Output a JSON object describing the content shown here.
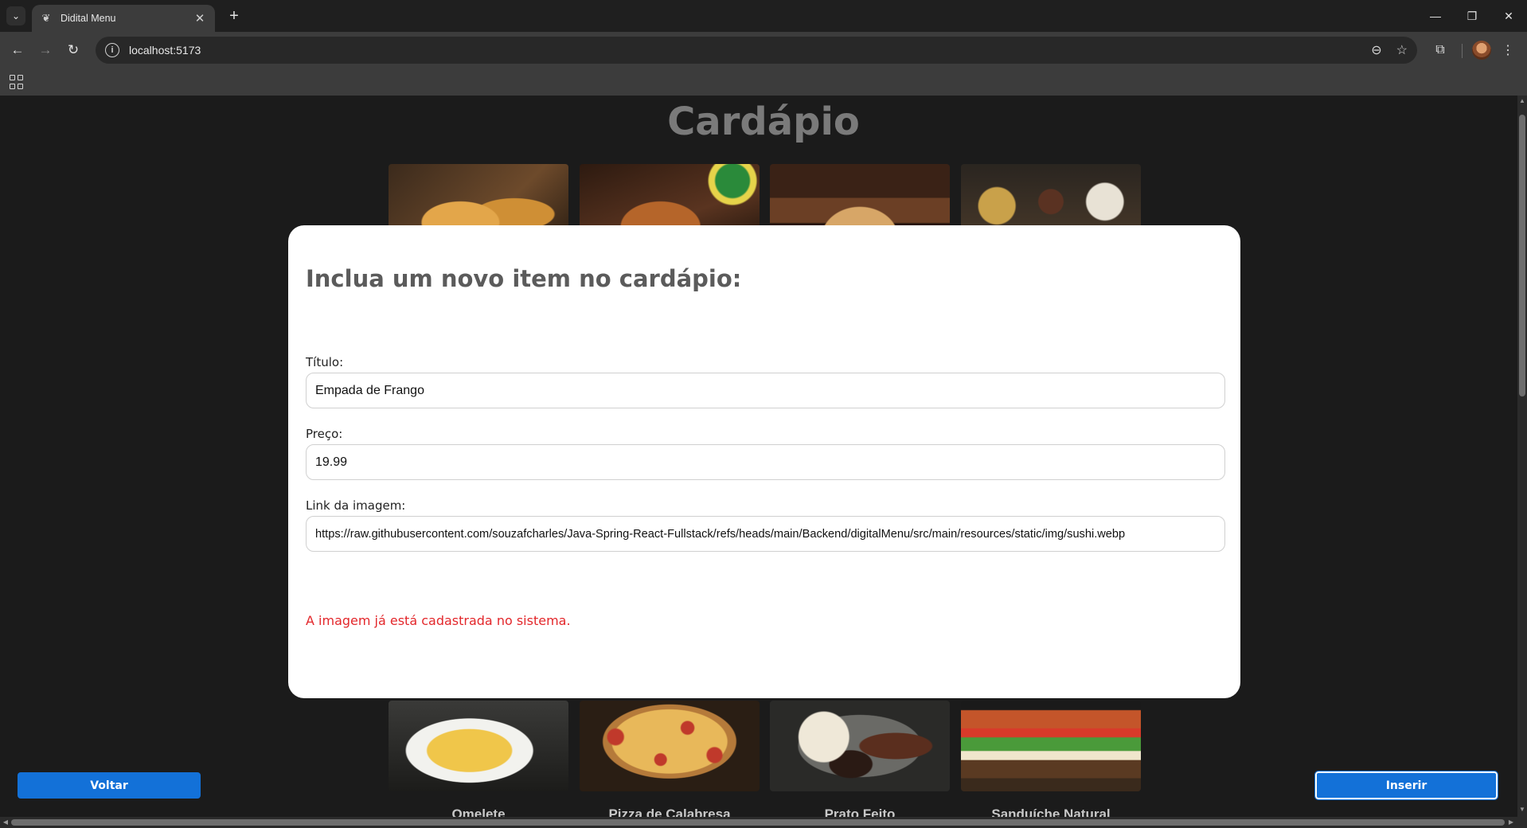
{
  "browser": {
    "tab_title": "Didital Menu",
    "url": "localhost:5173",
    "icons": {
      "tab_list": "chevron-down-icon",
      "favicon": "leaf-icon",
      "tab_close": "close-icon",
      "new_tab": "plus-icon",
      "back": "arrow-left-icon",
      "forward": "arrow-right-icon",
      "reload": "reload-icon",
      "site_info": "info-icon",
      "zoom": "zoom-icon",
      "bookmark": "star-icon",
      "extensions": "puzzle-icon",
      "menu": "kebab-icon",
      "apps": "apps-grid-icon"
    },
    "glyphs": {
      "tab_list": "⌄",
      "favicon": "❦",
      "tab_close": "✕",
      "new_tab": "+",
      "back": "←",
      "forward": "→",
      "reload": "↻",
      "site_info": "i",
      "zoom": "⊖",
      "bookmark": "☆",
      "extensions": "⧉",
      "menu": "⋮",
      "minimize": "—",
      "restore": "❐",
      "close": "✕"
    }
  },
  "page": {
    "title": "Cardápio",
    "top_cards": [
      {
        "image": "fries-image"
      },
      {
        "image": "coxinha-image"
      },
      {
        "image": "restaurant-image"
      },
      {
        "image": "spices-image"
      }
    ],
    "bottom_cards": [
      {
        "image": "omelete-image",
        "label": "Omelete"
      },
      {
        "image": "pizza-image",
        "label": "Pizza de Calabresa"
      },
      {
        "image": "prato-feito-image",
        "label": "Prato Feito"
      },
      {
        "image": "sanduiche-image",
        "label": "Sanduíche Natural"
      }
    ],
    "back_button": "Voltar",
    "insert_button": "Inserir"
  },
  "modal": {
    "title": "Inclua um novo item no cardápio:",
    "fields": {
      "title_label": "Título:",
      "title_value": "Empada de Frango",
      "price_label": "Preço:",
      "price_value": "19.99",
      "image_label": "Link da imagem:",
      "image_value": "https://raw.githubusercontent.com/souzafcharles/Java-Spring-React-Fullstack/refs/heads/main/Backend/digitalMenu/src/main/resources/static/img/sushi.webp"
    },
    "error": "A imagem já está cadastrada no sistema."
  },
  "colors": {
    "accent": "#1371d8",
    "error": "#e3272b",
    "page_bg": "#1b1b1b"
  }
}
